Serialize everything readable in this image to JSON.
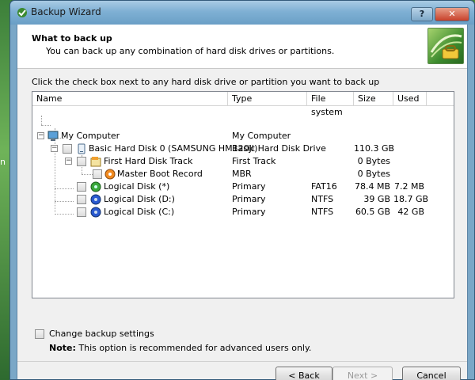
{
  "desktop": {
    "edge_letter": "n"
  },
  "window": {
    "title": "Backup Wizard",
    "help_label": "?",
    "close_label": "✕",
    "titlebar_color": "#7fb0d4"
  },
  "header": {
    "title": "What to back up",
    "subtitle": "You can back up any combination of hard disk drives or partitions."
  },
  "instruction": "Click the check box next to any hard disk drive or partition you want to back up",
  "table": {
    "columns": [
      "Name",
      "Type",
      "File system",
      "Size",
      "Used"
    ],
    "rows": [
      {
        "name": "My Computer",
        "type": "My Computer",
        "fs": "",
        "size": "",
        "used": "",
        "icon": "computer-icon"
      },
      {
        "name": "Basic Hard Disk 0 (SAMSUNG HM120JI)",
        "type": "Basic Hard Disk Drive",
        "fs": "",
        "size": "110.3 GB",
        "used": "",
        "icon": "hard-disk-icon"
      },
      {
        "name": "First Hard Disk Track",
        "type": "First Track",
        "fs": "",
        "size": "0 Bytes",
        "used": "",
        "icon": "disk-track-icon"
      },
      {
        "name": "Master Boot Record",
        "type": "MBR",
        "fs": "",
        "size": "0 Bytes",
        "used": "",
        "icon": "mbr-icon"
      },
      {
        "name": "Logical Disk (*)",
        "type": "Primary",
        "fs": "FAT16",
        "size": "78.4 MB",
        "used": "7.2 MB",
        "icon": "partition-green-icon"
      },
      {
        "name": "Logical Disk (D:)",
        "type": "Primary",
        "fs": "NTFS",
        "size": "39 GB",
        "used": "18.7 GB",
        "icon": "partition-blue-icon"
      },
      {
        "name": "Logical Disk (C:)",
        "type": "Primary",
        "fs": "NTFS",
        "size": "60.5 GB",
        "used": "42 GB",
        "icon": "partition-blue-icon"
      }
    ]
  },
  "options": {
    "change_settings_label": "Change backup settings",
    "note_label": "Note:",
    "note_text": " This option is recommended for advanced users only."
  },
  "buttons": {
    "back": "< Back",
    "next": "Next >",
    "cancel": "Cancel"
  }
}
